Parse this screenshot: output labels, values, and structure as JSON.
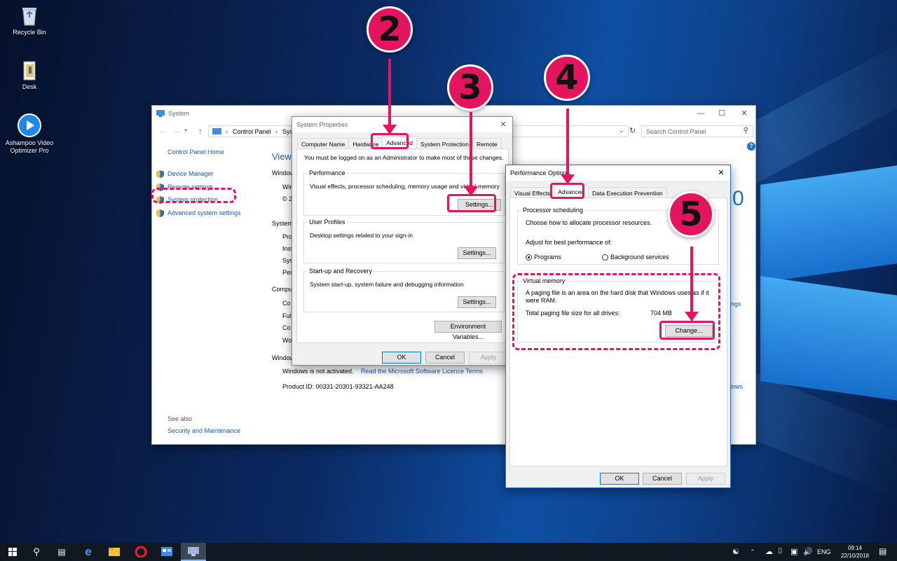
{
  "desktop": {
    "icons": [
      {
        "label": "Recycle Bin",
        "icon": "recycle-bin-icon"
      },
      {
        "label": "Desk",
        "icon": "folder-icon"
      },
      {
        "label": "Ashampoo Video Optimizer Pro",
        "icon": "app-play-icon"
      }
    ]
  },
  "system_window": {
    "title": "System",
    "address": {
      "crumbs": [
        "Control Panel",
        "Sys"
      ],
      "search_placeholder": "Search Control Panel"
    },
    "sidebar": {
      "home": "Control Panel Home",
      "links": [
        "Device Manager",
        "Remote settings",
        "System protection",
        "Advanced system settings"
      ],
      "see_also": "See also",
      "security": "Security and Maintenance"
    },
    "main": {
      "heading": "View",
      "fragments": [
        "Windows",
        "Wir",
        "© 2",
        "System",
        "Pro",
        "Inst",
        "Sys",
        "Per",
        "Compu",
        "Co",
        "Ful",
        "Co",
        "Wo",
        "Window"
      ],
      "activation_text": "Windows is not activated.",
      "licence_link": "Read the Microsoft Software Licence Terms",
      "product_id": "Product ID:  00331-20301-93321-AA248",
      "right_big": "0",
      "right_links": [
        "ings",
        "dows"
      ]
    }
  },
  "system_properties": {
    "title": "System Properties",
    "tabs": [
      "Computer Name",
      "Hardware",
      "Advanced",
      "System Protection",
      "Remote"
    ],
    "active_tab": "Advanced",
    "admin_note": "You must be logged on as an Administrator to make most of these changes.",
    "performance": {
      "title": "Performance",
      "desc": "Visual effects, processor scheduling, memory usage and virtual memory",
      "button": "Settings..."
    },
    "user_profiles": {
      "title": "User Profiles",
      "desc": "Desktop settings related to your sign-in",
      "button": "Settings..."
    },
    "startup": {
      "title": "Start-up and Recovery",
      "desc": "System start-up, system failure and debugging information",
      "button": "Settings..."
    },
    "env_button": "Environment Variables...",
    "ok": "OK",
    "cancel": "Cancel",
    "apply": "Apply"
  },
  "performance_options": {
    "title": "Performance Options",
    "tabs": [
      "Visual Effects",
      "Advanced",
      "Data Execution Prevention"
    ],
    "active_tab": "Advanced",
    "processor": {
      "title": "Processor scheduling",
      "desc": "Choose how to allocate processor resources.",
      "adjust": "Adjust for best performance of:",
      "options": [
        "Programs",
        "Background services"
      ],
      "selected": "Programs"
    },
    "virtual_memory": {
      "title": "Virtual memory",
      "desc": "A paging file is an area on the hard disk that Windows uses as if it were RAM.",
      "total_label": "Total paging file size for all drives:",
      "total_value": "704 MB",
      "button": "Change..."
    },
    "ok": "OK",
    "cancel": "Cancel",
    "apply": "Apply"
  },
  "annotations": {
    "steps": [
      "2",
      "3",
      "4",
      "5"
    ],
    "color": "#e4145f"
  },
  "taskbar": {
    "apps": [
      "start-icon",
      "search-icon",
      "task-view-icon",
      "edge-icon",
      "file-explorer-icon",
      "opera-icon",
      "control-panel-icon",
      "system-icon"
    ],
    "tray": {
      "lang": "ENG",
      "time": "09:14",
      "date": "22/10/2018"
    }
  }
}
